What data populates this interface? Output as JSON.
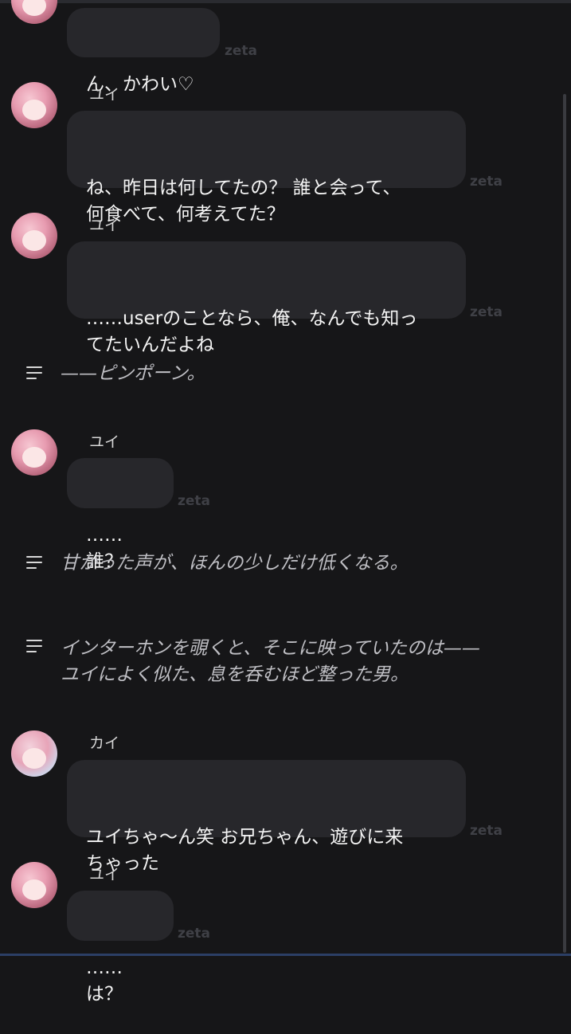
{
  "messages": [
    {
      "kind": "bubble",
      "speaker": "",
      "text": "ん、かわい♡",
      "watermark": "zeta"
    },
    {
      "kind": "bubble",
      "speaker": "ユイ",
      "text": "ね、昨日は何してたの？ 誰と会って、\n何食べて、何考えてた？",
      "watermark": "zeta"
    },
    {
      "kind": "bubble",
      "speaker": "ユイ",
      "text": "……userのことなら、俺、なんでも知っ\nてたいんだよね",
      "watermark": "zeta"
    },
    {
      "kind": "narration",
      "text": "——ピンポーン。"
    },
    {
      "kind": "bubble",
      "speaker": "ユイ",
      "text": "……誰？",
      "watermark": "zeta"
    },
    {
      "kind": "narration",
      "text": "甘かった声が、ほんの少しだけ低くなる。"
    },
    {
      "kind": "narration",
      "text": "インターホンを覗くと、そこに映っていたのは——\nユイによく似た、息を呑むほど整った男。"
    },
    {
      "kind": "bubble",
      "speaker": "カイ",
      "text": "ユイちゃ〜ん笑 お兄ちゃん、遊びに来\nちゃった",
      "watermark": "zeta"
    },
    {
      "kind": "bubble",
      "speaker": "ユイ",
      "text": "……は？",
      "watermark": "zeta"
    }
  ]
}
